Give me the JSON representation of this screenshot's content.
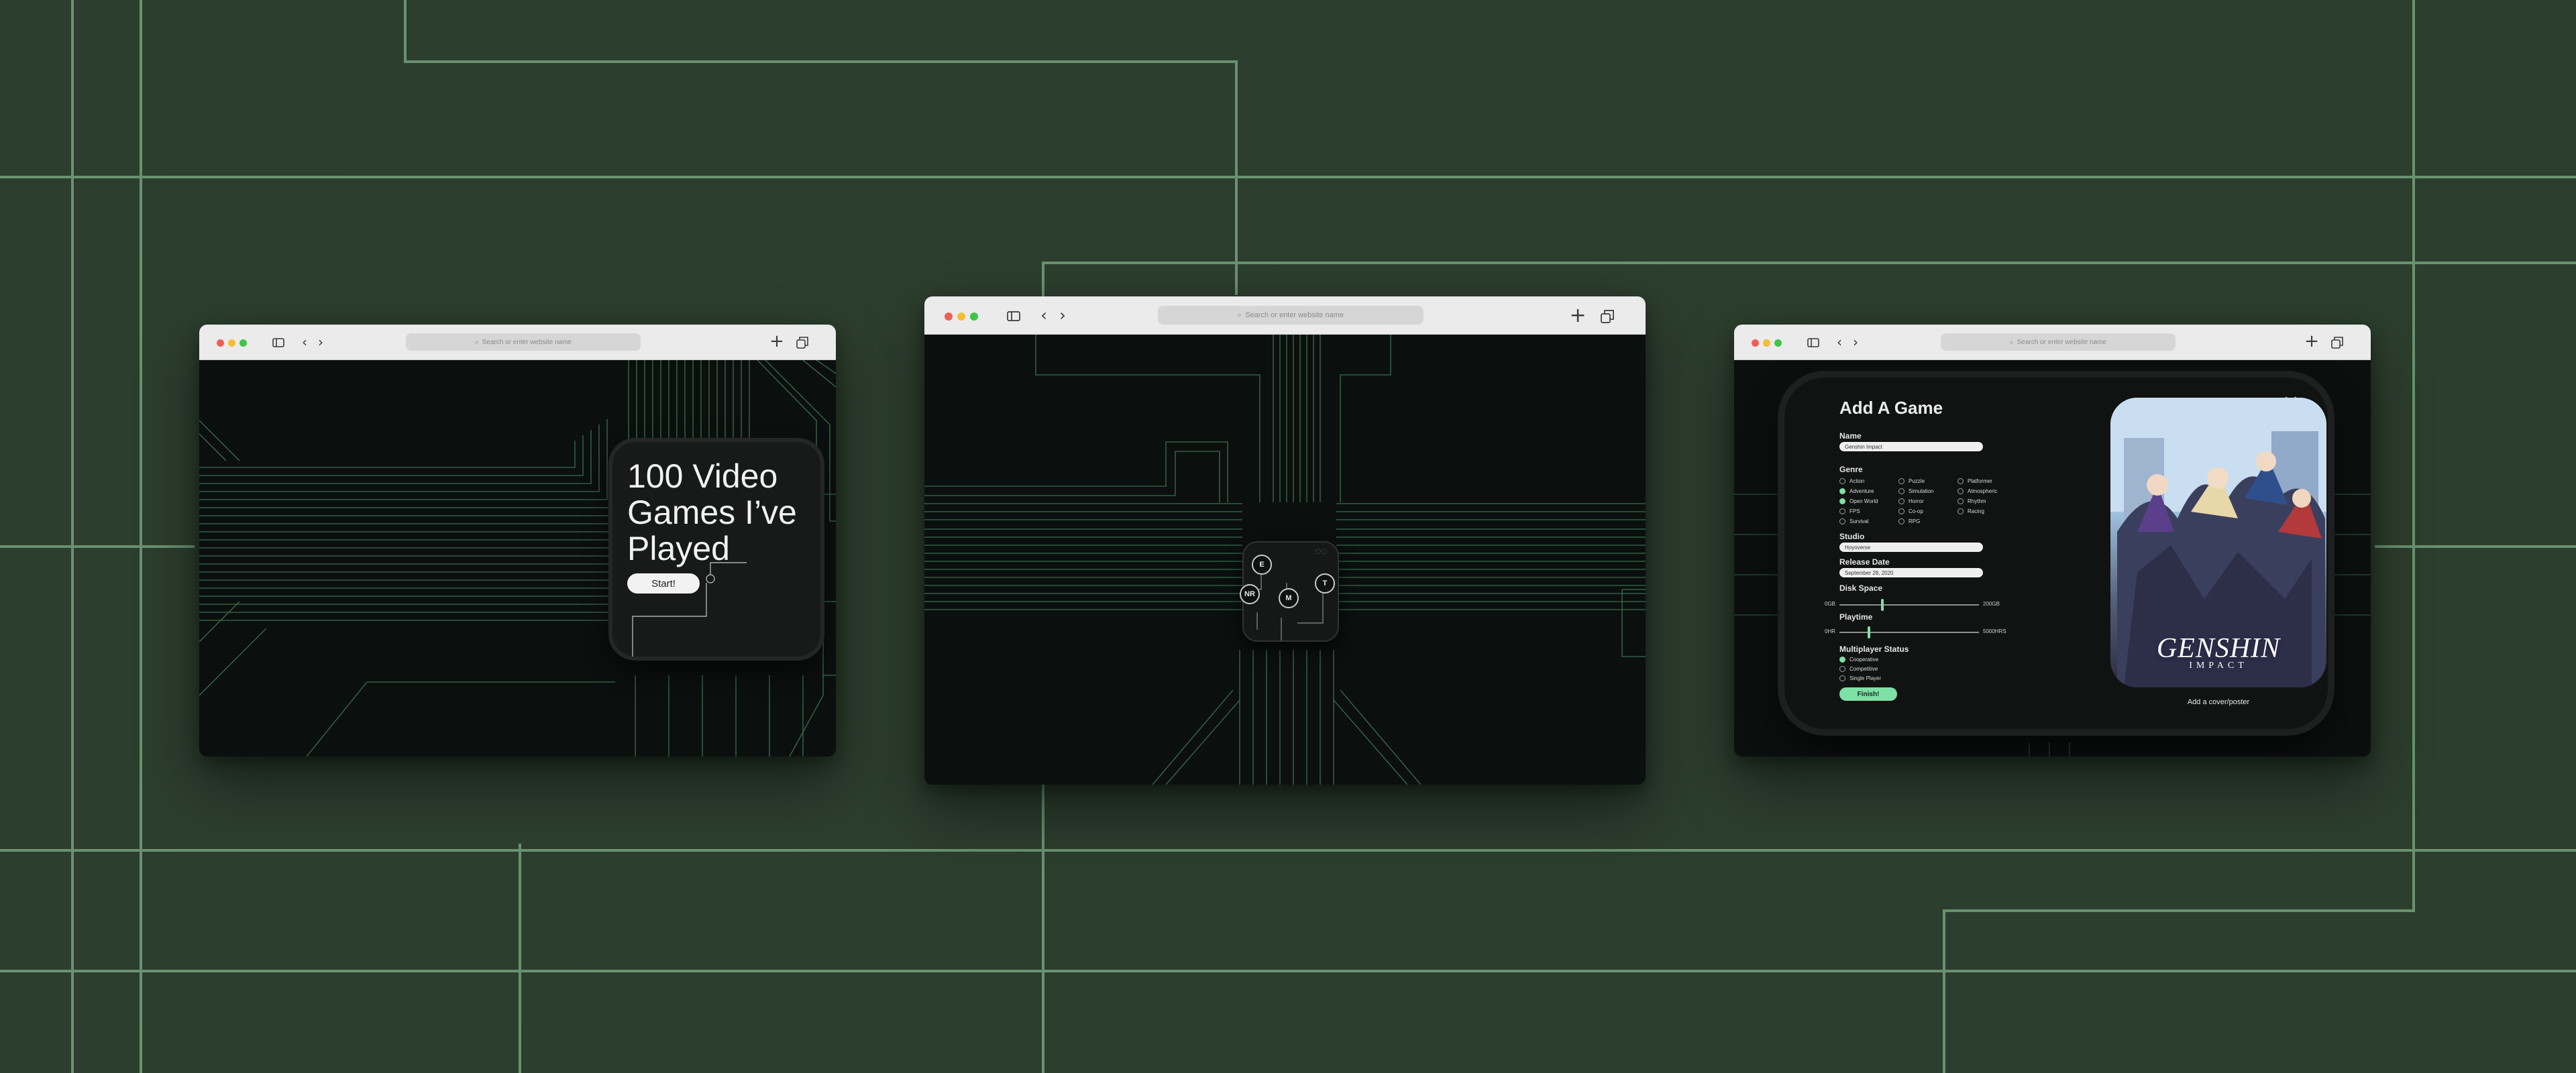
{
  "browser": {
    "address_placeholder": "Search or enter website name",
    "icons": [
      "sidebar-icon",
      "back-icon",
      "forward-icon",
      "new-tab-icon",
      "tabs-overview-icon"
    ]
  },
  "colors": {
    "background": "#2c3e2e",
    "line": "#7eae86",
    "accent": "#7fe0a6",
    "circuit": "#3f7a56"
  },
  "screen1": {
    "title": "100 Video Games I’ve Played",
    "start_label": "Start!"
  },
  "screen2": {
    "nodes": [
      "E",
      "NR",
      "M",
      "T"
    ]
  },
  "screen3": {
    "title": "Add A Game",
    "close_icon": "close-x-icon",
    "name_label": "Name",
    "name_value": "Genshin Impact",
    "genre_label": "Genre",
    "genres": [
      {
        "label": "Action",
        "selected": false
      },
      {
        "label": "Puzzle",
        "selected": false
      },
      {
        "label": "Platformer",
        "selected": false
      },
      {
        "label": "Adventure",
        "selected": true
      },
      {
        "label": "Simulation",
        "selected": false
      },
      {
        "label": "Atmospheric",
        "selected": false
      },
      {
        "label": "Open World",
        "selected": true
      },
      {
        "label": "Horror",
        "selected": false
      },
      {
        "label": "Rhythm",
        "selected": false
      },
      {
        "label": "FPS",
        "selected": false
      },
      {
        "label": "Co-op",
        "selected": false
      },
      {
        "label": "Racing",
        "selected": false
      },
      {
        "label": "Survival",
        "selected": false
      },
      {
        "label": "RPG",
        "selected": false
      }
    ],
    "studio_label": "Studio",
    "studio_value": "Hoyoverse",
    "release_label": "Release Date",
    "release_value": "September 28, 2020",
    "disk_label": "Disk Space",
    "disk_min": "0GB",
    "disk_max": "200GB",
    "disk_fraction": 0.3,
    "playtime_label": "Playtime",
    "playtime_min": "0HR",
    "playtime_max": "5000HRS",
    "playtime_fraction": 0.2,
    "multiplayer_label": "Multiplayer Status",
    "multiplayer_options": [
      {
        "label": "Cooperative",
        "selected": true
      },
      {
        "label": "Competitive",
        "selected": false
      },
      {
        "label": "Single Player",
        "selected": false
      }
    ],
    "finish_label": "Finish!",
    "poster_logo": "GENSHIN",
    "poster_logo_sub": "IMPACT",
    "poster_caption": "Add a cover/poster"
  }
}
